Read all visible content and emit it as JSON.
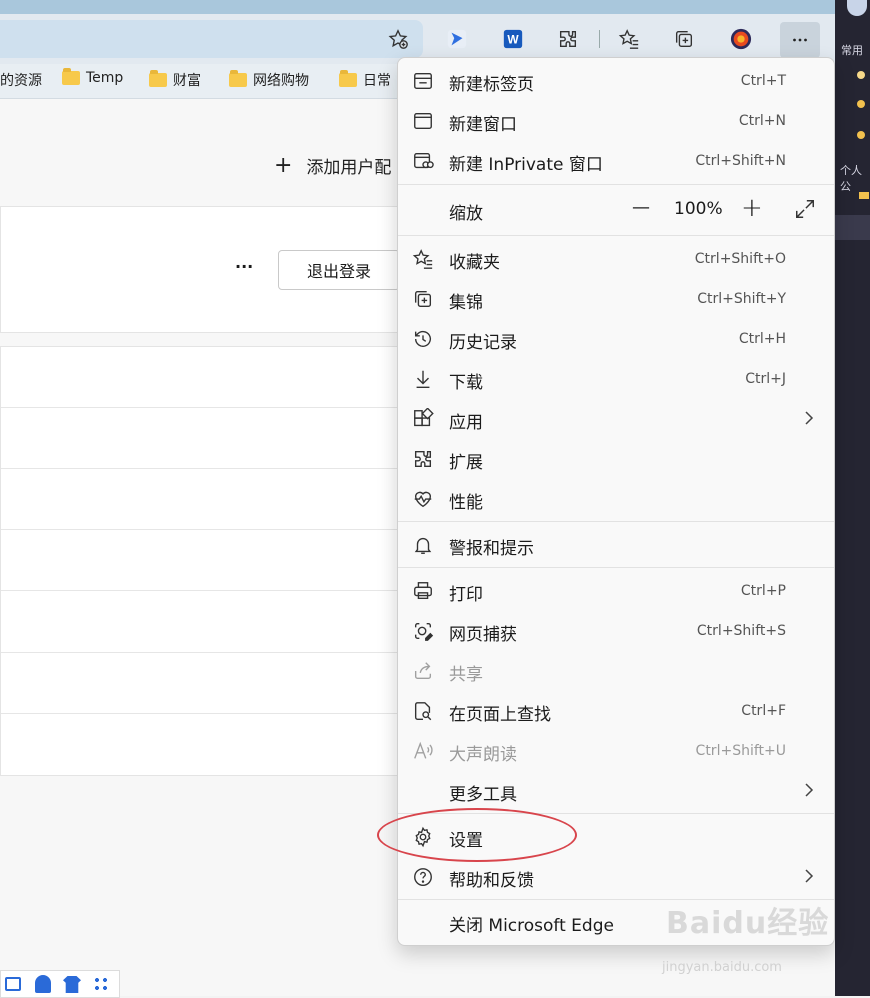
{
  "bookmarks": [
    "的资源",
    "Temp",
    "财富",
    "网络购物",
    "日常"
  ],
  "page": {
    "add_profile": "添加用户配",
    "more_dots": "···",
    "sign_out": "退出登录"
  },
  "right_panel": {
    "label_common": "常用",
    "label_personal": "个人公"
  },
  "menu": {
    "new_tab": {
      "label": "新建标签页",
      "shortcut": "Ctrl+T"
    },
    "new_window": {
      "label": "新建窗口",
      "shortcut": "Ctrl+N"
    },
    "new_inprivate": {
      "label": "新建 InPrivate 窗口",
      "shortcut": "Ctrl+Shift+N"
    },
    "zoom": {
      "label": "缩放",
      "minus": "—",
      "value": "100%",
      "plus": "+"
    },
    "favorites": {
      "label": "收藏夹",
      "shortcut": "Ctrl+Shift+O"
    },
    "collections": {
      "label": "集锦",
      "shortcut": "Ctrl+Shift+Y"
    },
    "history": {
      "label": "历史记录",
      "shortcut": "Ctrl+H"
    },
    "downloads": {
      "label": "下载",
      "shortcut": "Ctrl+J"
    },
    "apps": {
      "label": "应用"
    },
    "extensions": {
      "label": "扩展"
    },
    "performance": {
      "label": "性能"
    },
    "alerts": {
      "label": "警报和提示"
    },
    "print": {
      "label": "打印",
      "shortcut": "Ctrl+P"
    },
    "web_capture": {
      "label": "网页捕获",
      "shortcut": "Ctrl+Shift+S"
    },
    "share": {
      "label": "共享"
    },
    "find": {
      "label": "在页面上查找",
      "shortcut": "Ctrl+F"
    },
    "read_aloud": {
      "label": "大声朗读",
      "shortcut": "Ctrl+Shift+U"
    },
    "more_tools": {
      "label": "更多工具"
    },
    "settings": {
      "label": "设置"
    },
    "help": {
      "label": "帮助和反馈"
    },
    "close_edge": {
      "label": "关闭 Microsoft Edge"
    }
  },
  "watermark": {
    "brand": "Baidu经验",
    "url": "jingyan.baidu.com"
  },
  "icons": [
    "star-add-icon",
    "copilot-icon",
    "word-icon",
    "extensions-icon",
    "favorites-icon",
    "collections-icon",
    "avatar",
    "more-icon",
    "new-tab-icon",
    "window-icon",
    "inprivate-icon",
    "expand-icon",
    "star-list-icon",
    "collections-icon",
    "history-icon",
    "download-icon",
    "apps-icon",
    "puzzle-icon",
    "heartbeat-icon",
    "bell-icon",
    "printer-icon",
    "capture-icon",
    "share-icon",
    "find-icon",
    "read-aloud-icon",
    "gear-icon",
    "help-icon"
  ],
  "colors": {
    "highlight_ellipse": "#d8454c",
    "menu_bg": "#f9f9f9"
  }
}
